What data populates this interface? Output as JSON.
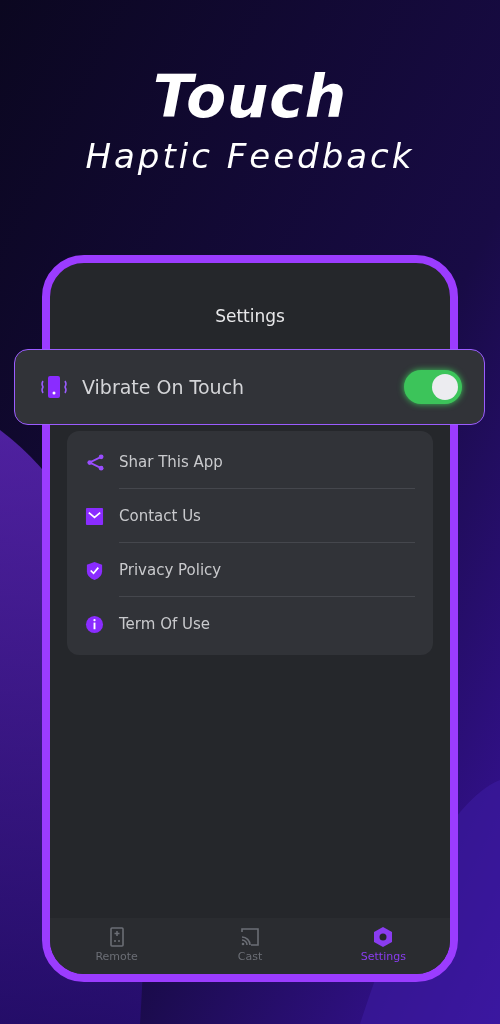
{
  "headline": {
    "title": "Touch",
    "subtitle": "Haptic Feedback"
  },
  "screen": {
    "title": "Settings",
    "vibrate": {
      "label": "Vibrate On Touch",
      "on": true
    },
    "menu": [
      {
        "label": "Shar This App"
      },
      {
        "label": "Contact Us"
      },
      {
        "label": "Privacy Policy"
      },
      {
        "label": "Term Of Use"
      }
    ],
    "tabs": [
      {
        "label": "Remote",
        "selected": false
      },
      {
        "label": "Cast",
        "selected": false
      },
      {
        "label": "Settings",
        "selected": true
      }
    ]
  }
}
